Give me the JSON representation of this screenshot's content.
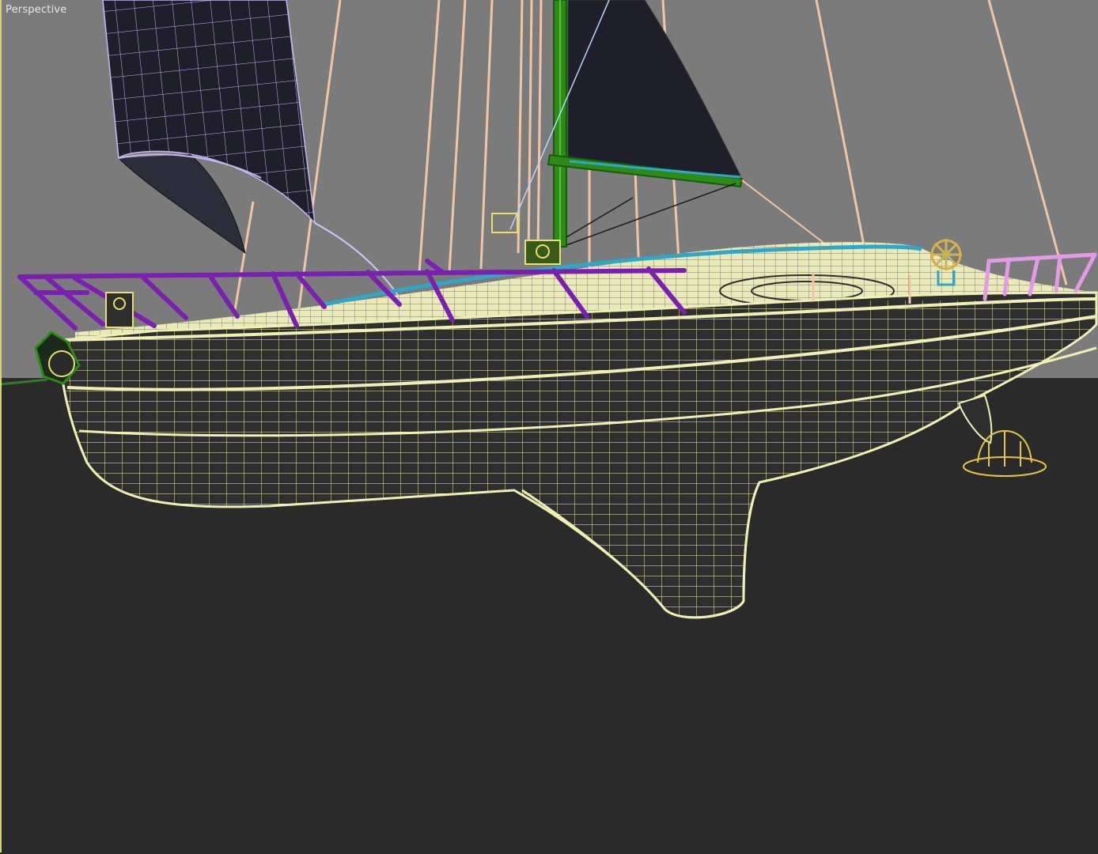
{
  "viewport": {
    "label": "Perspective"
  },
  "scene": {
    "colors": {
      "background_sky": "#7b7b7b",
      "background_ground": "#2a2a2a",
      "hull_wire": "#f0f0b4",
      "hull_fill": "#2e2e2e",
      "deck_fill": "#e9eab8",
      "railing": "#7a1fb0",
      "stern_railing": "#e39be6",
      "rigging": "#f1c6a6",
      "mast": "#2d8a16",
      "sail": "#1f1f2c",
      "sail_wire": "#c9b6f2",
      "toe_rail": "#2fa7c9",
      "wheel": "#d6b04a",
      "frame": "#d8d36a"
    },
    "objects": [
      "hull",
      "keel",
      "rudder",
      "deck",
      "mast",
      "boom",
      "mainsail",
      "spinnaker",
      "rigging",
      "bow-pulpit",
      "stern-pulpit",
      "lifelines",
      "helm-wheel",
      "winch",
      "hull-selection-box"
    ]
  }
}
